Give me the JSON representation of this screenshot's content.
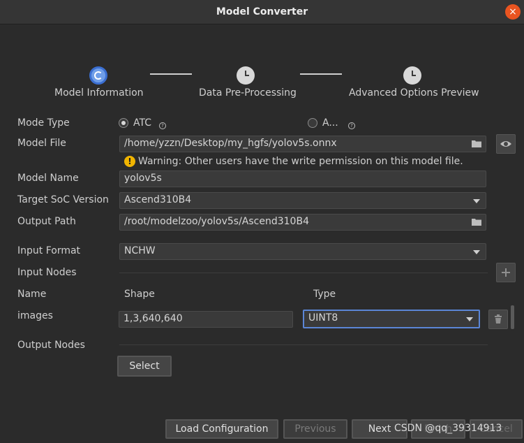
{
  "window": {
    "title": "Model Converter",
    "close_glyph": "×"
  },
  "steps": [
    {
      "label": "Model Information",
      "state": "active",
      "icon": "loading-icon"
    },
    {
      "label": "Data Pre-Processing",
      "state": "pending",
      "icon": "clock-icon"
    },
    {
      "label": "Advanced Options  Preview",
      "state": "pending",
      "icon": "clock-icon"
    }
  ],
  "form": {
    "mode_type": {
      "label": "Mode Type",
      "options": [
        "ATC",
        "A..."
      ],
      "selected": "ATC",
      "help_glyph": "?"
    },
    "model_file": {
      "label": "Model File",
      "value": "/home/yzzn/Desktop/my_hgfs/yolov5s.onnx",
      "warning": "Warning: Other users have the write permission on this model file.",
      "warning_glyph": "!"
    },
    "model_name": {
      "label": "Model Name",
      "value": "yolov5s"
    },
    "target_soc": {
      "label": "Target SoC Version",
      "value": "Ascend310B4"
    },
    "output_path": {
      "label": "Output Path",
      "value": "/root/modelzoo/yolov5s/Ascend310B4"
    },
    "input_format": {
      "label": "Input Format",
      "value": "NCHW"
    },
    "input_nodes": {
      "label": "Input Nodes",
      "columns": {
        "name": "Name",
        "shape": "Shape",
        "type": "Type"
      },
      "rows": [
        {
          "name": "images",
          "shape": "1,3,640,640",
          "type": "UINT8"
        }
      ]
    },
    "output_nodes": {
      "label": "Output Nodes",
      "select_label": "Select"
    }
  },
  "footer": {
    "load_label": "Load Configuration",
    "previous_label": "Previous",
    "next_label": "Next",
    "finish_label": "Finish",
    "cancel_label": "Cancel",
    "watermark": "CSDN @qq_39314913"
  },
  "colors": {
    "accent": "#5b86d6",
    "warning": "#f0b400",
    "close": "#e95420"
  }
}
